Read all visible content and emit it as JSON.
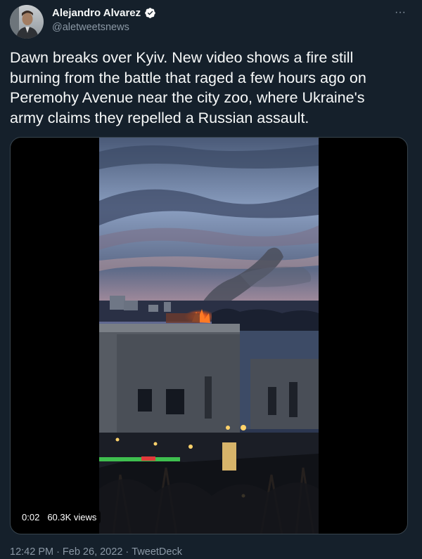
{
  "author": {
    "display_name": "Alejandro Alvarez",
    "handle": "@aletweetsnews",
    "verified": true,
    "avatar_icon": "person-photo-avatar"
  },
  "more_button": {
    "label": "···",
    "icon": "more-horizontal-icon"
  },
  "tweet": {
    "text": "Dawn breaks over Kyiv. New video shows a fire still\nburning from the battle that raged a few hours ago on\nPeremohy Avenue near the city zoo, where Ukraine's\narmy claims they repelled a Russian assault."
  },
  "media": {
    "type": "video",
    "duration": "0:02",
    "views": "60.3K views"
  },
  "footer": {
    "time": "12:42 PM",
    "separator1": "·",
    "date": "Feb 26, 2022",
    "separator2": "·",
    "source": "TweetDeck"
  },
  "colors": {
    "background": "#15202b",
    "text_primary": "#f7f9f9",
    "text_secondary": "#8b98a5",
    "verified_badge": "#ffffff",
    "border": "#38444d"
  }
}
